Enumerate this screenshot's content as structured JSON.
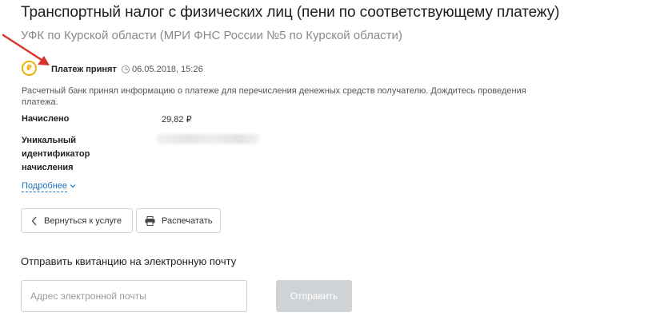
{
  "header": {
    "title": "Транспортный налог с физических лиц (пени по соответствующему платежу)",
    "subtitle": "УФК по Курской области (МРИ ФНС России №5 по Курской области)"
  },
  "payment": {
    "status_icon_symbol": "₽",
    "status_label": "Платеж принят",
    "status_datetime": "06.05.2018, 15:26",
    "bank_message": "Расчетный банк принял информацию о платеже для перечисления денежных средств получателю. Дождитесь проведения платежа.",
    "accrued_label": "Начислено",
    "accrued_value": "29,82 ₽",
    "uid_label": "Уникальный идентификатор начисления",
    "more_link": "Подробнее"
  },
  "actions": {
    "back_label": "Вернуться к услуге",
    "print_label": "Распечатать"
  },
  "email": {
    "heading": "Отправить квитанцию на электронную почту",
    "input_value": "",
    "input_placeholder": "Адрес электронной почты",
    "send_label": "Отправить"
  },
  "colors": {
    "status_accent": "#e8b20d",
    "link": "#1e73be",
    "arrow": "#d9342b",
    "send_button_disabled": "#d0d3d6"
  },
  "icons": {
    "status": "ruble-coin-icon",
    "time": "clock-icon",
    "expand": "chevron-down-icon",
    "back": "chevron-left-icon",
    "print": "printer-icon",
    "annotation": "red-arrow-icon"
  }
}
